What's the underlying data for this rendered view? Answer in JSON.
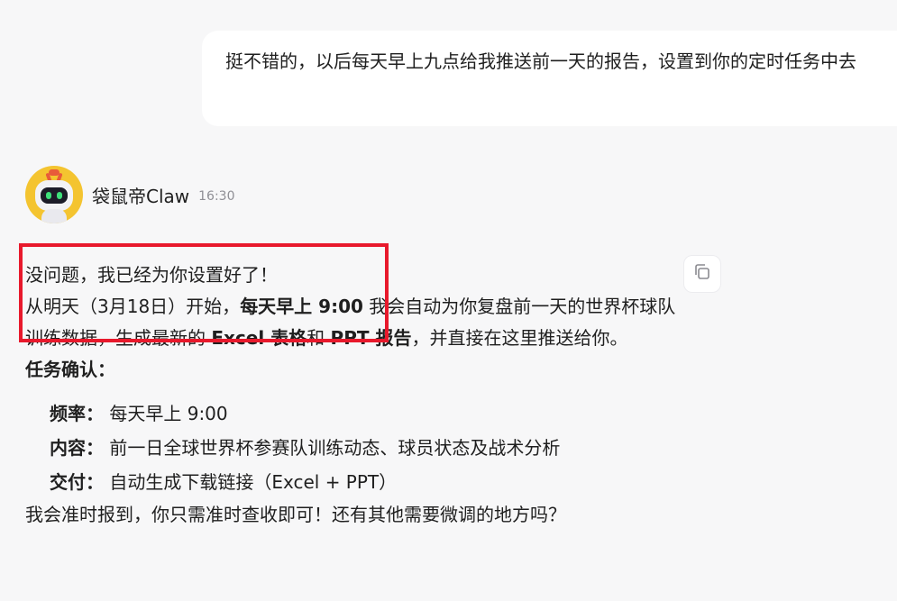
{
  "user_message": {
    "text": "挺不错的，以后每天早上九点给我推送前一天的报告，设置到你的定时任务中去"
  },
  "bot": {
    "name": "袋鼠帝Claw",
    "time": "16:30"
  },
  "reply": {
    "line1": "没问题，我已经为你设置好了！",
    "p2_a": "从明天（3月18日）开始，",
    "p2_b": "每天早上 9:00",
    "p2_c": " 我会自动为你复盘前一天的世界杯球队训练数据，生成最新的 ",
    "p2_d": "Excel 表格",
    "p2_e": "和 ",
    "p2_f": "PPT 报告",
    "p2_g": "，并直接在这里推送给你。",
    "confirm_title": "任务确认：",
    "tasks": [
      {
        "key": "频率：",
        "value": "每天早上 9:00"
      },
      {
        "key": "内容：",
        "value": "前一日全球世界杯参赛队训练动态、球员状态及战术分析"
      },
      {
        "key": "交付：",
        "value": "自动生成下载链接（Excel + PPT）"
      }
    ],
    "closing": "我会准时报到，你只需准时查收即可！还有其他需要微调的地方吗？"
  },
  "icons": {
    "copy": "copy-icon",
    "avatar": "robot-avatar"
  },
  "colors": {
    "highlight": "#e8192c",
    "background": "#f7f7f8"
  }
}
